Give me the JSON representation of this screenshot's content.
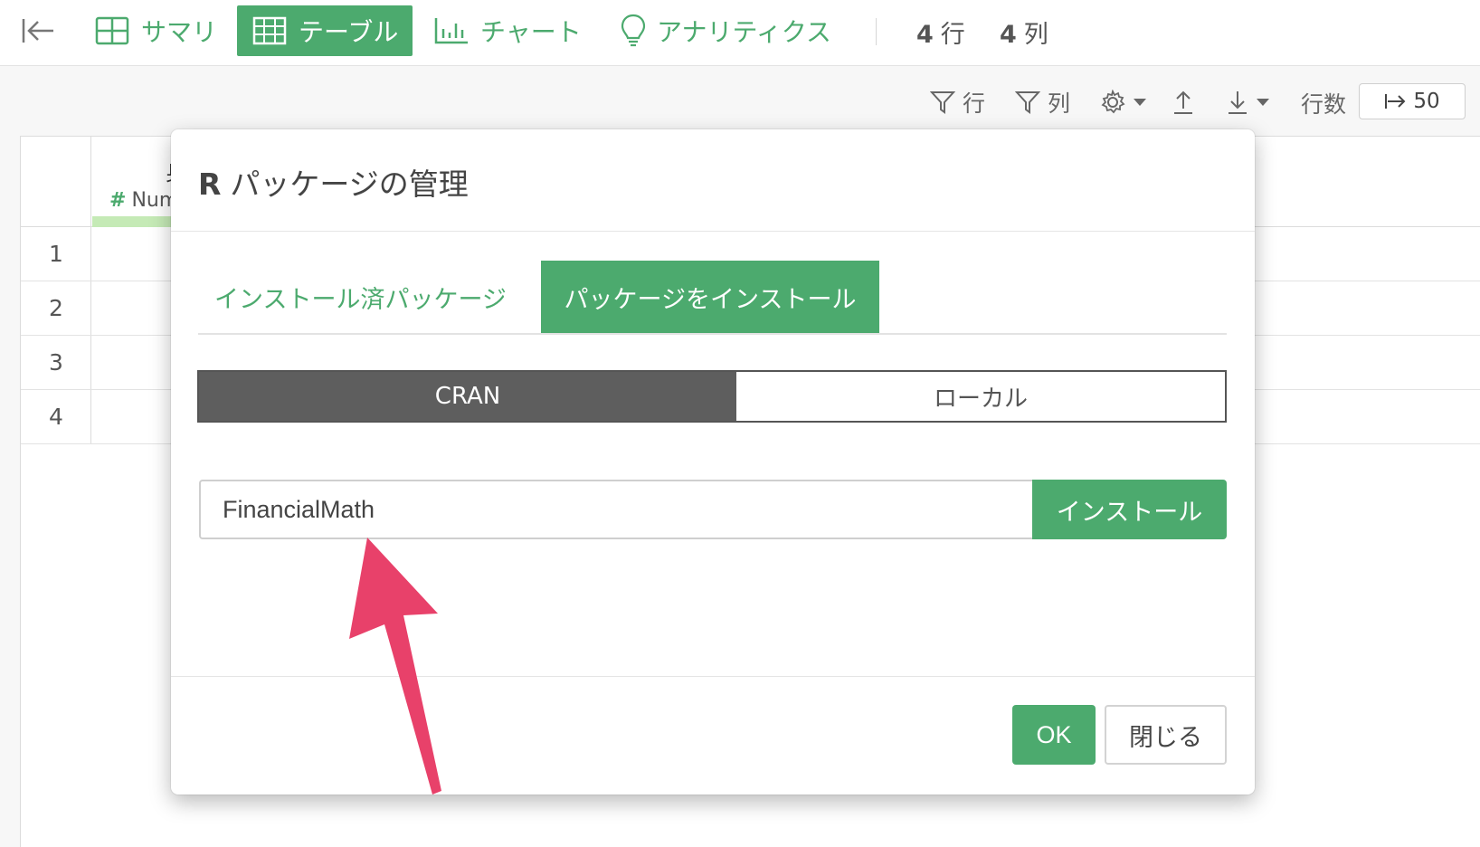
{
  "toolbar": {
    "back_icon": "collapse-left-icon",
    "views": [
      {
        "label": "サマリ",
        "icon": "summary-grid-icon",
        "active": false
      },
      {
        "label": "テーブル",
        "icon": "table-icon",
        "active": true
      },
      {
        "label": "チャート",
        "icon": "bar-chart-icon",
        "active": false
      },
      {
        "label": "アナリティクス",
        "icon": "lightbulb-icon",
        "active": false
      }
    ],
    "row_count": "4",
    "row_unit": "行",
    "col_count": "4",
    "col_unit": "列"
  },
  "subtoolbar": {
    "filter_rows_label": "行",
    "filter_cols_label": "列",
    "rows_label": "行数",
    "rows_value": "50"
  },
  "table": {
    "col_type_label": "Num",
    "col_head_char": "身",
    "row_numbers": [
      "1",
      "2",
      "3",
      "4"
    ]
  },
  "modal": {
    "title_prefix": "R",
    "title": "パッケージの管理",
    "tabs": [
      {
        "label": "インストール済パッケージ",
        "active": false
      },
      {
        "label": "パッケージをインストール",
        "active": true
      }
    ],
    "source_options": [
      {
        "label": "CRAN",
        "selected": true
      },
      {
        "label": "ローカル",
        "selected": false
      }
    ],
    "package_input_value": "FinancialMath",
    "install_button": "インストール",
    "ok_button": "OK",
    "close_button": "閉じる"
  },
  "colors": {
    "accent": "#4caa6e",
    "segment_selected": "#5e5e5e",
    "annotation_arrow": "#e8416a"
  }
}
